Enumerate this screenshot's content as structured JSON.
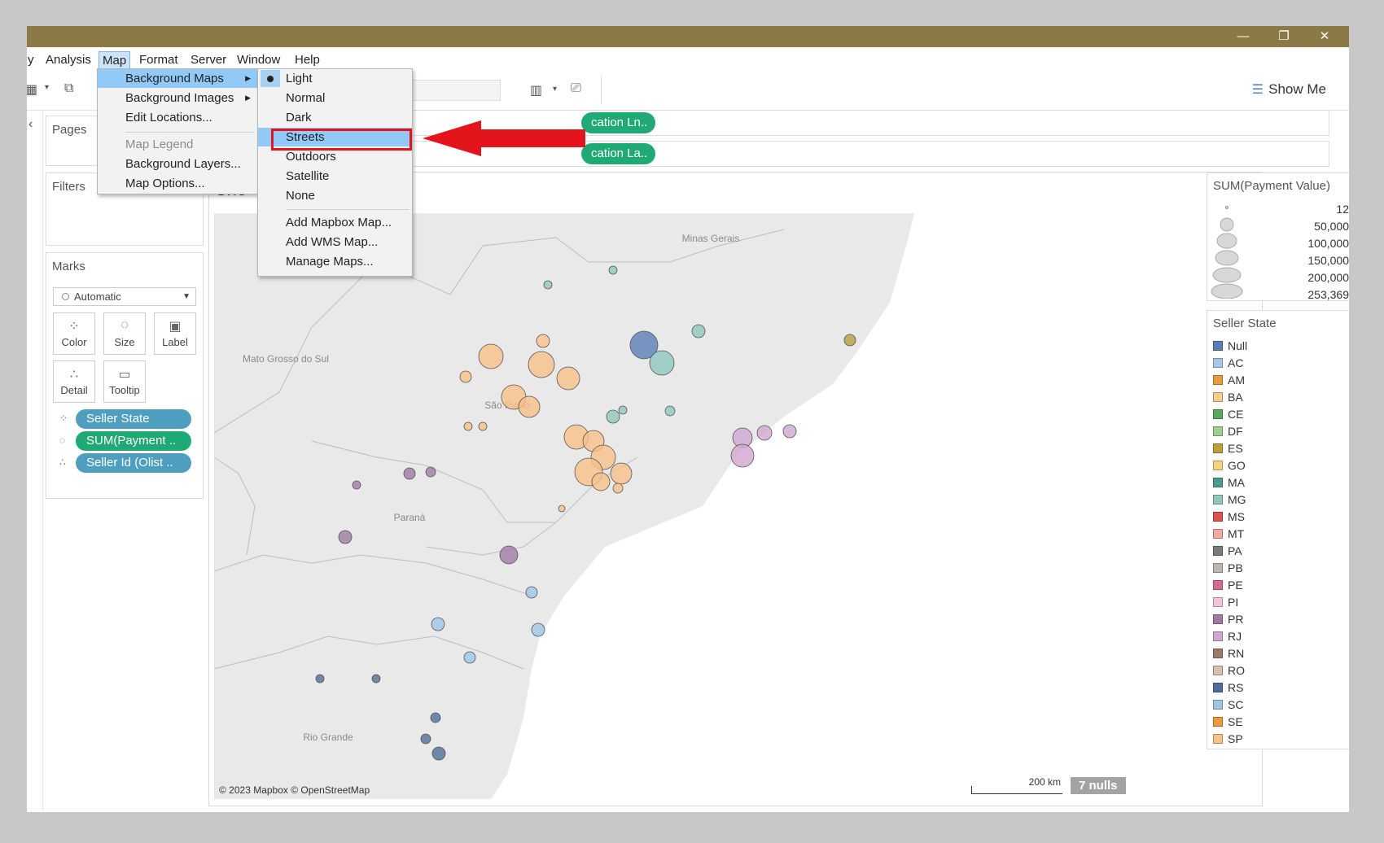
{
  "window": {
    "minimize": "—",
    "restore": "❐",
    "close": "✕"
  },
  "menubar": [
    {
      "label": "y"
    },
    {
      "label": "Analysis"
    },
    {
      "label": "Map",
      "active": true
    },
    {
      "label": "Format"
    },
    {
      "label": "Server"
    },
    {
      "label": "Window"
    },
    {
      "label": "Help"
    }
  ],
  "toolbar": {
    "show_me": "Show Me"
  },
  "pages": {
    "title": "Pages"
  },
  "filters": {
    "title": "Filters"
  },
  "shelves": {
    "columns_pill": "cation Ln..",
    "rows_pill": "cation La.."
  },
  "marks": {
    "title": "Marks",
    "mark_type": "Automatic",
    "buttons": {
      "color": "Color",
      "size": "Size",
      "label": "Label",
      "detail": "Detail",
      "tooltip": "Tooltip"
    },
    "pills": [
      {
        "label": "Seller State",
        "color": "#4e9fbf"
      },
      {
        "label": "SUM(Payment ..",
        "color": "#1fa974"
      },
      {
        "label": "Seller Id (Olist ..",
        "color": "#4e9fbf"
      }
    ]
  },
  "sheet": {
    "title": "She"
  },
  "map": {
    "labels": [
      "Minas Gerais",
      "Mato Grosso do Sul",
      "São Paulo",
      "Paraná",
      "Rio Grande"
    ],
    "credit": "© 2023 Mapbox © OpenStreetMap",
    "scale": "200 km",
    "nulls": "7 nulls"
  },
  "size_legend": {
    "title": "SUM(Payment Value)",
    "items": [
      "12",
      "50,000",
      "100,000",
      "150,000",
      "200,000",
      "253,369"
    ]
  },
  "color_legend": {
    "title": "Seller State",
    "items": [
      {
        "label": "Null",
        "color": "#5a7db5"
      },
      {
        "label": "AC",
        "color": "#a9c8e6"
      },
      {
        "label": "AM",
        "color": "#e89a3c"
      },
      {
        "label": "BA",
        "color": "#f7c98a"
      },
      {
        "label": "CE",
        "color": "#5aa85a"
      },
      {
        "label": "DF",
        "color": "#9fd18a"
      },
      {
        "label": "ES",
        "color": "#b8a03a"
      },
      {
        "label": "GO",
        "color": "#f2d57e"
      },
      {
        "label": "MA",
        "color": "#4e9a93"
      },
      {
        "label": "MG",
        "color": "#8fc7bf"
      },
      {
        "label": "MS",
        "color": "#d9534f"
      },
      {
        "label": "MT",
        "color": "#f2a9a3"
      },
      {
        "label": "PA",
        "color": "#7a7a7a"
      },
      {
        "label": "PB",
        "color": "#bdb6ae"
      },
      {
        "label": "PE",
        "color": "#d36b94"
      },
      {
        "label": "PI",
        "color": "#f4c4d6"
      },
      {
        "label": "PR",
        "color": "#a07aa5"
      },
      {
        "label": "RJ",
        "color": "#d1a6cf"
      },
      {
        "label": "RN",
        "color": "#9b7b6b"
      },
      {
        "label": "RO",
        "color": "#d8bfae"
      },
      {
        "label": "RS",
        "color": "#4f6f9a"
      },
      {
        "label": "SC",
        "color": "#9fc5e6"
      },
      {
        "label": "SE",
        "color": "#e89a3c"
      },
      {
        "label": "SP",
        "color": "#f9c08a"
      }
    ]
  },
  "map_menu": {
    "items": [
      {
        "label": "Background Maps",
        "submenu": true,
        "highlight": true
      },
      {
        "label": "Background Images",
        "submenu": true
      },
      {
        "label": "Edit Locations..."
      },
      {
        "label": "Map Legend",
        "disabled": true
      },
      {
        "label": "Background Layers..."
      },
      {
        "label": "Map Options..."
      }
    ]
  },
  "background_maps_submenu": {
    "items": [
      {
        "label": "Light",
        "selected": true
      },
      {
        "label": "Normal"
      },
      {
        "label": "Dark"
      },
      {
        "label": "Streets",
        "highlight": true
      },
      {
        "label": "Outdoors"
      },
      {
        "label": "Satellite"
      },
      {
        "label": "None"
      },
      {
        "label": "Add Mapbox Map..."
      },
      {
        "label": "Add WMS Map..."
      },
      {
        "label": "Manage Maps..."
      }
    ]
  }
}
